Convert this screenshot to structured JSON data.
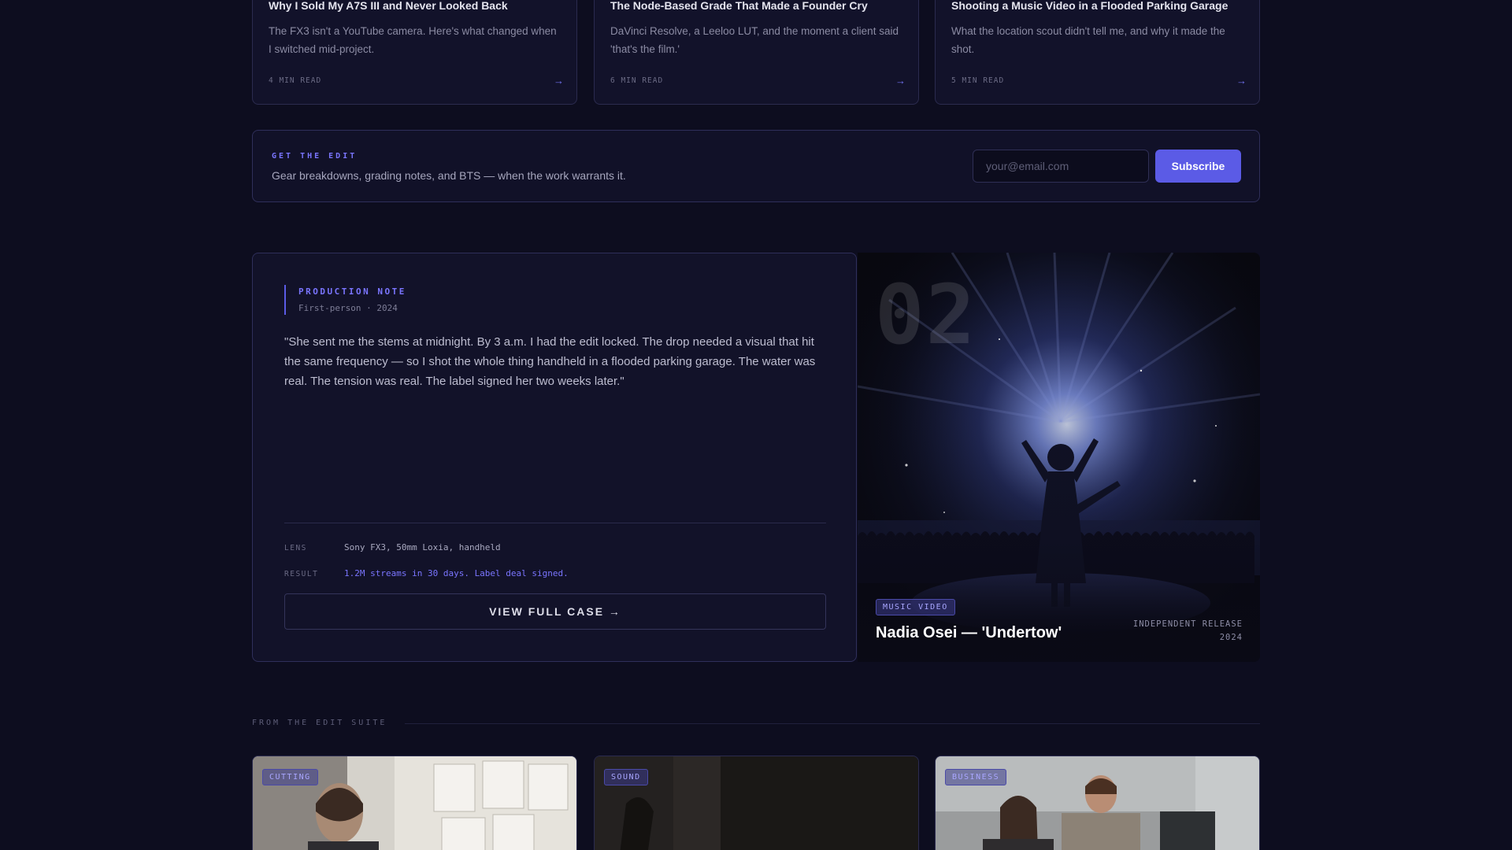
{
  "top_cards": [
    {
      "title": "Why I Sold My A7S III and Never Looked Back",
      "description": "The FX3 isn't a YouTube camera. Here's what changed when I switched mid-project.",
      "meta": "4 MIN READ",
      "arrow": "→"
    },
    {
      "title": "The Node-Based Grade That Made a Founder Cry",
      "description": "DaVinci Resolve, a Leeloo LUT, and the moment a client said 'that's the film.'",
      "meta": "6 MIN READ",
      "arrow": "→"
    },
    {
      "title": "Shooting a Music Video in a Flooded Parking Garage",
      "description": "What the location scout didn't tell me, and why it made the shot.",
      "meta": "5 MIN READ",
      "arrow": "→"
    }
  ],
  "newsletter": {
    "kicker": "GET THE EDIT",
    "text": "Gear breakdowns, grading notes, and BTS — when the work warrants it.",
    "email_placeholder": "your@email.com",
    "subscribe_label": "Subscribe"
  },
  "case_study": {
    "kicker": "PRODUCTION NOTE",
    "meta": "First-person · 2024",
    "quote": "\"She sent me the stems at midnight. By 3 a.m. I had the edit locked. The drop needed a visual that hit the same frequency — so I shot the whole thing handheld in a flooded parking garage. The water was real. The tension was real. The label signed her two weeks later.\"",
    "lens_label": "LENS",
    "lens_value": "Sony FX3, 50mm Loxia, handheld",
    "result_label": "RESULT",
    "result_value": "1.2M streams in 30 days. Label deal signed.",
    "cta": "VIEW FULL CASE →",
    "image": {
      "number": "02",
      "tag": "MUSIC VIDEO",
      "title": "Nadia Osei — 'Undertow'",
      "meta_line1": "INDEPENDENT RELEASE",
      "meta_line2": "2024"
    }
  },
  "suite": {
    "section_label": "FROM THE EDIT SUITE",
    "cards": [
      {
        "tag": "CUTTING"
      },
      {
        "tag": "SOUND"
      },
      {
        "tag": "BUSINESS"
      }
    ]
  },
  "colors": {
    "background": "#0d0d1f",
    "accent": "#5b5be6",
    "accent_text": "#7a75ff"
  }
}
